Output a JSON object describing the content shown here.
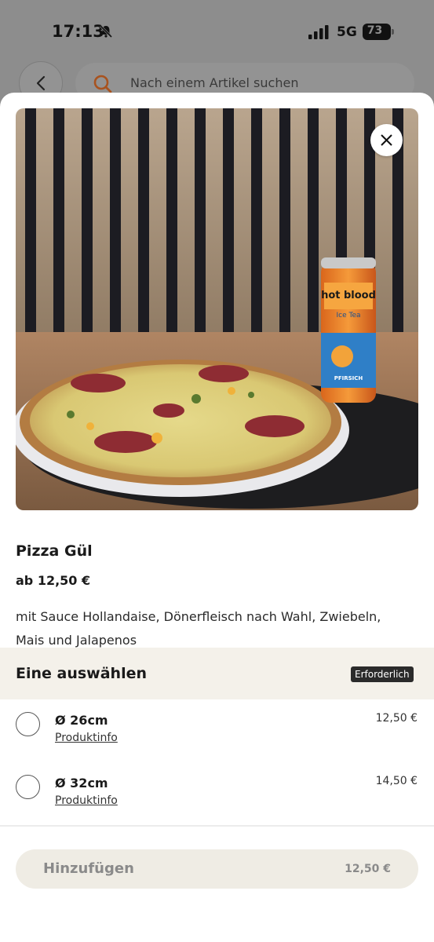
{
  "status_bar": {
    "time": "17:13",
    "network": "5G",
    "battery": "73"
  },
  "search": {
    "placeholder": "Nach einem Artikel suchen"
  },
  "product": {
    "title": "Pizza Gül",
    "price": "ab 12,50 €",
    "description": "mit Sauce Hollandaise, Dönerfleisch nach Wahl, Zwiebeln, Mais und Jalapenos",
    "image_can_text": [
      "hot blood",
      "Ice Tea",
      "PFIRSICH"
    ]
  },
  "options": {
    "title": "Eine auswählen",
    "badge": "Erforderlich",
    "items": [
      {
        "label": "Ø 26cm",
        "info": "Produktinfo",
        "price": "12,50 €"
      },
      {
        "label": "Ø 32cm",
        "info": "Produktinfo",
        "price": "14,50 €"
      }
    ]
  },
  "add_button": {
    "label": "Hinzufügen",
    "price": "12,50 €"
  },
  "colors": {
    "accent": "#e8641e",
    "badge": "#2b2b2b",
    "options_bg": "#f4f1ea",
    "add_bg": "#efece4"
  }
}
